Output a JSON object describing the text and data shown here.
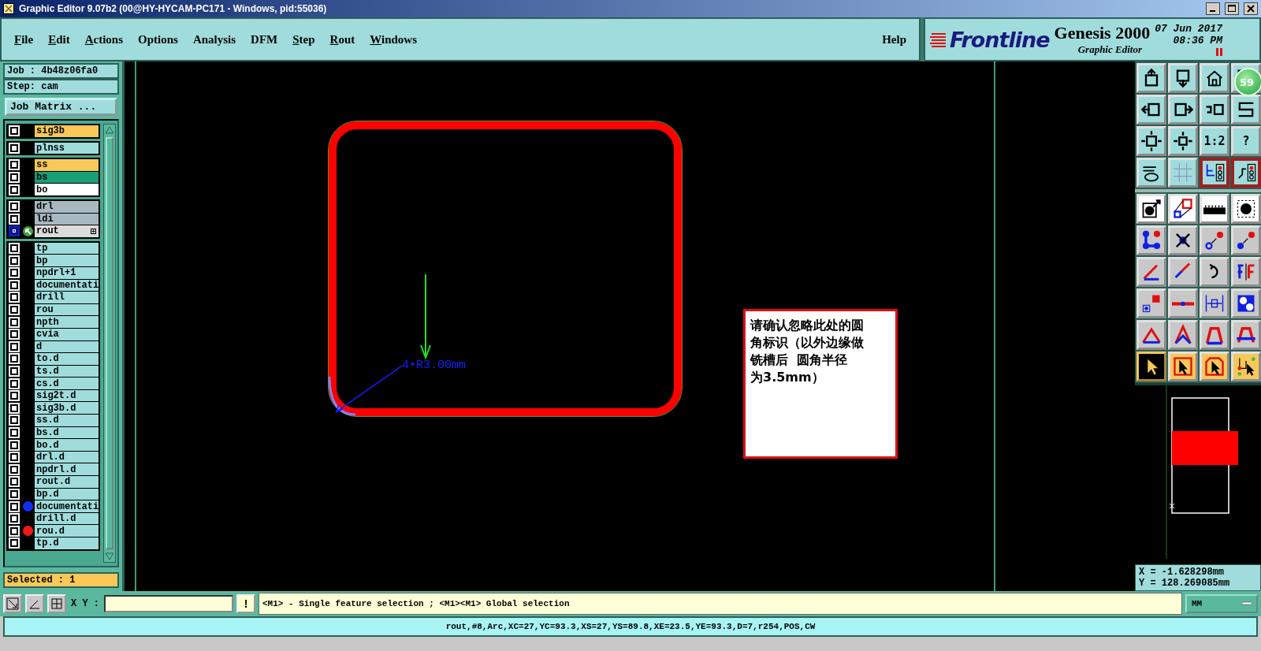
{
  "window": {
    "title": "Graphic Editor 9.07b2 (00@HY-HYCAM-PC171 - Windows, pid:55036)"
  },
  "menu": [
    {
      "label": "File",
      "mnemonic": true
    },
    {
      "label": "Edit",
      "mnemonic": true
    },
    {
      "label": "Actions",
      "mnemonic": true
    },
    {
      "label": "Options",
      "mnemonic": false
    },
    {
      "label": "Analysis",
      "mnemonic": false
    },
    {
      "label": "DFM",
      "mnemonic": false
    },
    {
      "label": "Step",
      "mnemonic": true
    },
    {
      "label": "Rout",
      "mnemonic": true
    },
    {
      "label": "Windows",
      "mnemonic": true
    }
  ],
  "help": "Help",
  "brand": {
    "logo": "Frontline",
    "product": "Genesis 2000",
    "subtitle": "Graphic Editor",
    "date": "07 Jun 2017",
    "time": "08:36 PM"
  },
  "job": {
    "job": "Job : 4b48z06fa0",
    "step": "Step: cam",
    "matrix_button": "Job Matrix ..."
  },
  "layer_groups": [
    [
      {
        "name": "sig3b",
        "color": "#f8c858",
        "work": false
      }
    ],
    [
      {
        "name": "plnss",
        "color": "#a0dcdc",
        "work": false
      }
    ],
    [
      {
        "name": "ss",
        "color": "#f8c858",
        "work": false
      },
      {
        "name": "bs",
        "color": "#18a078",
        "work": false
      },
      {
        "name": "bo",
        "color": "#ffffff",
        "work": false
      }
    ],
    [
      {
        "name": "drl",
        "color": "#a8b8c0",
        "work": false
      },
      {
        "name": "ldi",
        "color": "#a8b8c0",
        "work": false
      },
      {
        "name": "rout",
        "color": "#dcdcdc",
        "work": true
      }
    ],
    [
      {
        "name": "tp",
        "color": "#a0dcdc",
        "work": false
      },
      {
        "name": "bp",
        "color": "#a0dcdc",
        "work": false
      },
      {
        "name": "npdrl+1",
        "color": "#a0dcdc",
        "work": false
      },
      {
        "name": "documentati",
        "color": "#a0dcdc",
        "work": false
      },
      {
        "name": "drill",
        "color": "#a0dcdc",
        "work": false
      },
      {
        "name": "rou",
        "color": "#a0dcdc",
        "work": false
      },
      {
        "name": "npth",
        "color": "#a0dcdc",
        "work": false
      },
      {
        "name": "cvia",
        "color": "#a0dcdc",
        "work": false
      },
      {
        "name": "d",
        "color": "#a0dcdc",
        "work": false
      },
      {
        "name": "to.d",
        "color": "#a0dcdc",
        "work": false
      },
      {
        "name": "ts.d",
        "color": "#a0dcdc",
        "work": false
      },
      {
        "name": "cs.d",
        "color": "#a0dcdc",
        "work": false
      },
      {
        "name": "sig2t.d",
        "color": "#a0dcdc",
        "work": false
      },
      {
        "name": "sig3b.d",
        "color": "#a0dcdc",
        "work": false
      },
      {
        "name": "ss.d",
        "color": "#a0dcdc",
        "work": false
      },
      {
        "name": "bs.d",
        "color": "#a0dcdc",
        "work": false
      },
      {
        "name": "bo.d",
        "color": "#a0dcdc",
        "work": false
      },
      {
        "name": "drl.d",
        "color": "#a0dcdc",
        "work": false
      },
      {
        "name": "npdrl.d",
        "color": "#a0dcdc",
        "work": false
      },
      {
        "name": "rout.d",
        "color": "#a0dcdc",
        "work": false
      },
      {
        "name": "bp.d",
        "color": "#a0dcdc",
        "work": false
      },
      {
        "name": "documentati",
        "color": "#a0dcdc",
        "work": false,
        "dot": {
          "color": "#1030f0"
        }
      },
      {
        "name": "drill.d",
        "color": "#a0dcdc",
        "work": false
      },
      {
        "name": "rou.d",
        "color": "#a0dcdc",
        "work": false,
        "dot": {
          "color": "#f01818"
        }
      },
      {
        "name": "tp.d",
        "color": "#a0dcdc",
        "work": false
      }
    ]
  ],
  "selected_count": "Selected : 1",
  "canvas": {
    "dimension": "4•R3.00mm",
    "note_lines": [
      "请确认忽略此处的圆",
      "角标识（以外边缘做",
      "铣槽后  圆角半径",
      "为3.5mm）"
    ]
  },
  "toolbar": [
    {
      "kind": "view",
      "on": false
    },
    {
      "kind": "view",
      "on": false
    },
    {
      "kind": "view",
      "on": false
    },
    {
      "kind": "view",
      "on": false
    },
    {
      "kind": "view",
      "on": false
    },
    {
      "kind": "view",
      "on": false
    },
    {
      "kind": "view",
      "on": false
    },
    {
      "kind": "view",
      "on": false
    },
    {
      "kind": "view",
      "on": false
    },
    {
      "kind": "view",
      "on": false
    },
    {
      "kind": "view",
      "on": false,
      "label": "1:2"
    },
    {
      "kind": "view",
      "on": false,
      "label": "?"
    },
    {
      "kind": "view",
      "on": false
    },
    {
      "kind": "view",
      "on": false
    },
    {
      "kind": "view",
      "on": true
    },
    {
      "kind": "view",
      "on": true
    },
    {
      "kind": "white",
      "on": false
    },
    {
      "kind": "white",
      "on": false
    },
    {
      "kind": "white",
      "on": false
    },
    {
      "kind": "white",
      "on": false
    },
    {
      "kind": "grey",
      "on": false
    },
    {
      "kind": "grey",
      "on": false
    },
    {
      "kind": "grey",
      "on": false
    },
    {
      "kind": "grey",
      "on": false
    },
    {
      "kind": "grey",
      "on": false
    },
    {
      "kind": "grey",
      "on": false
    },
    {
      "kind": "grey",
      "on": false
    },
    {
      "kind": "grey",
      "on": false
    },
    {
      "kind": "grey",
      "on": false
    },
    {
      "kind": "grey",
      "on": false
    },
    {
      "kind": "grey",
      "on": false
    },
    {
      "kind": "grey",
      "on": false
    },
    {
      "kind": "grey",
      "on": false
    },
    {
      "kind": "grey",
      "on": false
    },
    {
      "kind": "grey",
      "on": false
    },
    {
      "kind": "grey",
      "on": false
    },
    {
      "kind": "pick",
      "on": true
    },
    {
      "kind": "pick",
      "on": false
    },
    {
      "kind": "pick",
      "on": false
    },
    {
      "kind": "pick",
      "on": false
    }
  ],
  "badge": "59",
  "coordinates": {
    "x": "X = -1.628298mm",
    "y": "Y = 128.269085mm"
  },
  "bottom": {
    "xy_label": "X Y :",
    "alert": "!",
    "message": "<M1> - Single feature selection ; <M1><M1> Global selection",
    "units": "MM"
  },
  "status": "rout,#8,Arc,XC=27,YC=93.3,XS=27,YS=89.8,XE=23.5,YE=93.3,D=7,r254,POS,CW"
}
